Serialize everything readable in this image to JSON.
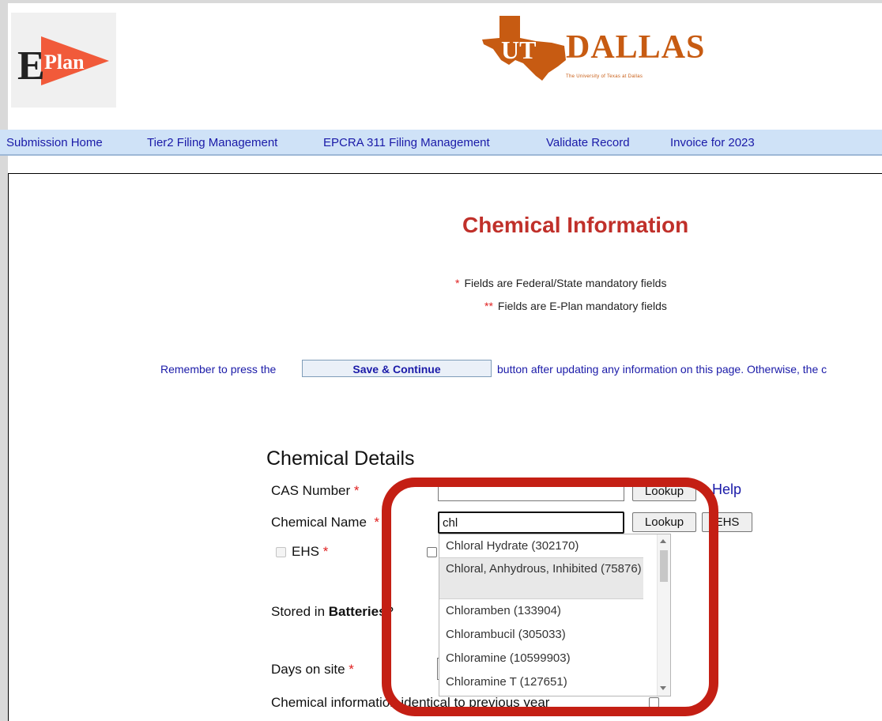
{
  "logos": {
    "eplan_letter": "E",
    "eplan_word": "Plan",
    "ut_word": "DALLAS",
    "ut_tagline": "The University of Texas at Dallas",
    "ut_overlay": "UT"
  },
  "nav": {
    "items": [
      "Submission Home",
      "Tier2 Filing Management",
      "EPCRA 311 Filing Management",
      "Validate Record",
      "Invoice for 2023"
    ]
  },
  "page": {
    "title": "Chemical Information",
    "mandatory_federal": "Fields are Federal/State mandatory fields",
    "mandatory_eplan": "Fields are E-Plan mandatory fields",
    "star_single": "*",
    "star_double": "**",
    "reminder_prefix": "Remember to press the",
    "save_button": "Save & Continue",
    "reminder_suffix": "button after updating any information on this page. Otherwise, the c"
  },
  "chemical_details": {
    "section_title": "Chemical Details",
    "cas_label": "CAS Number",
    "cas_value": "",
    "name_label": "Chemical Name",
    "name_value": "chl",
    "lookup_label": "Lookup",
    "help_label": "Help",
    "ehs_button": "EHS",
    "ehs_label": "EHS",
    "batteries_prefix": "Stored in ",
    "batteries_bold": "Batteries",
    "batteries_suffix": "?",
    "days_label": "Days on site",
    "identical_label": "Chemical information identical to previous year",
    "required_mark": "*"
  },
  "autocomplete": {
    "items": [
      "Chloral Hydrate (302170)",
      "Chloral, Anhydrous, Inhibited (75876)",
      "Chloramben (133904)",
      "Chlorambucil (305033)",
      "Chloramine (10599903)",
      "Chloramine T (127651)"
    ],
    "highlighted_index": 1
  },
  "colors": {
    "highlight_ring": "#c41f14",
    "title": "#c0302a",
    "nav_bg": "#cfe2f7",
    "link": "#1a1aa8"
  }
}
